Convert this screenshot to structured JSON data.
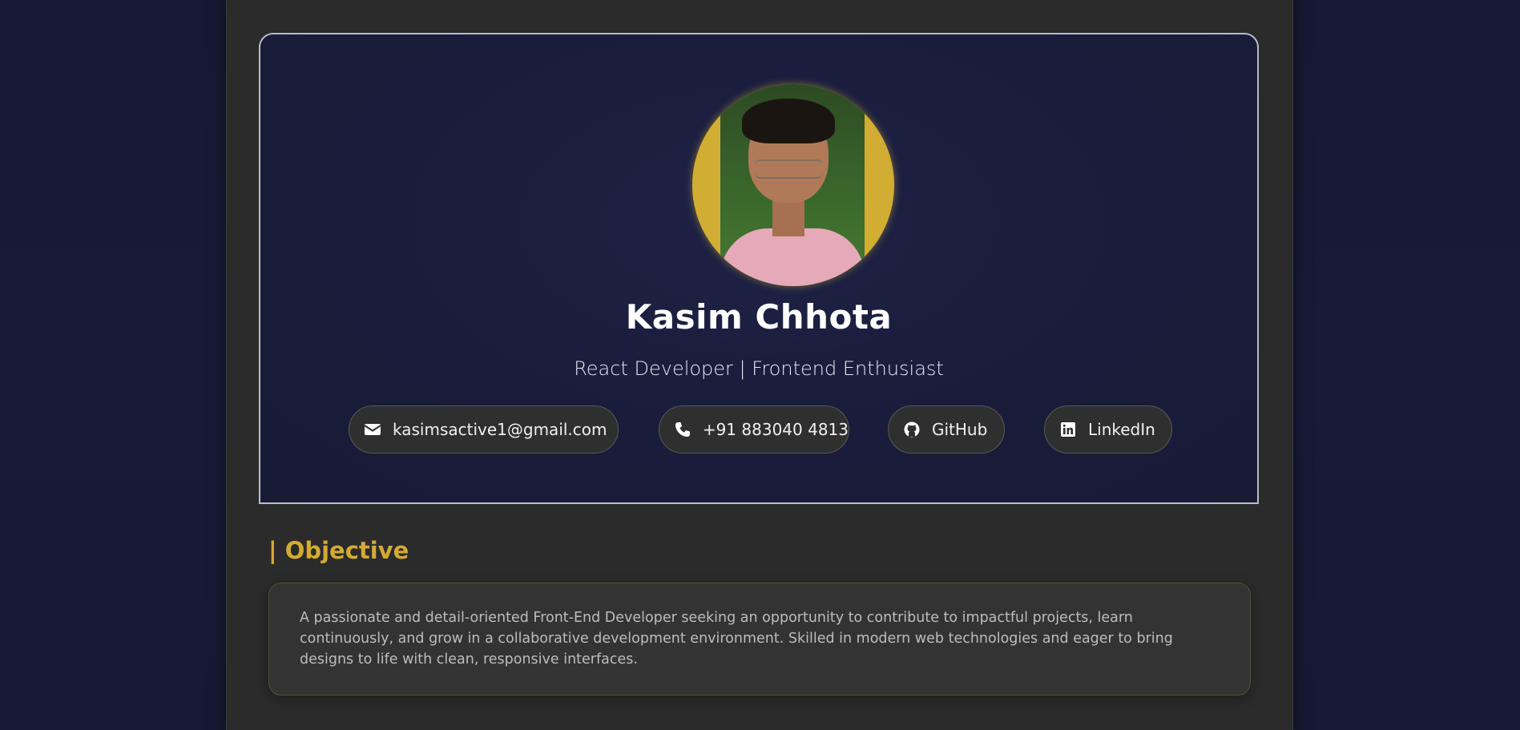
{
  "profile": {
    "name": "Kasim Chhota",
    "subtitle": "React Developer | Frontend Enthusiast",
    "avatar_alt": "profile-photo"
  },
  "contacts": {
    "email": {
      "label": "kasimsactive1@gmail.com",
      "icon": "envelope-icon"
    },
    "phone": {
      "label": "+91 883040 4813",
      "icon": "phone-icon"
    },
    "github": {
      "label": "GitHub",
      "icon": "github-icon"
    },
    "linkedin": {
      "label": "LinkedIn",
      "icon": "linkedin-icon"
    }
  },
  "objective": {
    "title": "| Objective",
    "text": "A passionate and detail-oriented Front-End Developer seeking an opportunity to contribute to impactful projects, learn continuously, and grow in a collaborative development environment. Skilled in modern web technologies and eager to bring designs to life with clean, responsive interfaces."
  },
  "colors": {
    "accent": "#d4ab32",
    "page_bg": "#151a35",
    "card_bg": "#2b2b2b",
    "header_bg": "#1a1e3d"
  }
}
